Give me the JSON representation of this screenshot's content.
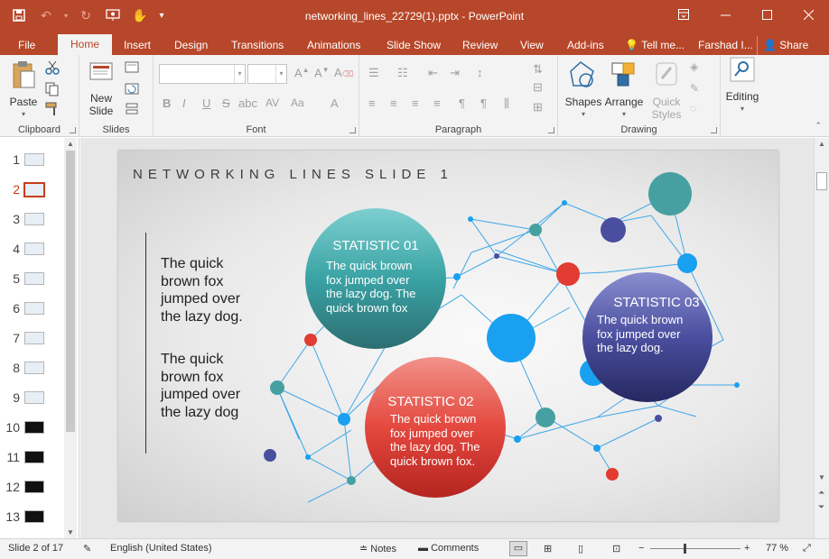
{
  "titlebar": {
    "doc_title": "networking_lines_22729(1).pptx - PowerPoint",
    "qat": {
      "save_icon": "save-icon",
      "undo_icon": "undo-icon",
      "redo_icon": "redo-icon"
    },
    "color": "#b7472a"
  },
  "tabs": [
    {
      "label": "File"
    },
    {
      "label": "Home"
    },
    {
      "label": "Insert"
    },
    {
      "label": "Design"
    },
    {
      "label": "Transitions"
    },
    {
      "label": "Animations"
    },
    {
      "label": "Slide Show"
    },
    {
      "label": "Review"
    },
    {
      "label": "View"
    },
    {
      "label": "Add-ins"
    },
    {
      "label": "Tell me..."
    },
    {
      "label": "Farshad I..."
    },
    {
      "label": "Share"
    }
  ],
  "ribbon": {
    "clipboard": {
      "label": "Clipboard",
      "paste_label": "Paste"
    },
    "slides": {
      "label": "Slides",
      "new_slide_label": "New Slide",
      "new_slide_line1": "New",
      "new_slide_line2": "Slide"
    },
    "font": {
      "label": "Font",
      "bold": "B",
      "italic": "I",
      "underline": "U",
      "strike": "S",
      "spacing": "AV",
      "case": "Aa",
      "color": "A"
    },
    "paragraph": {
      "label": "Paragraph"
    },
    "drawing": {
      "label": "Drawing",
      "shapes_label": "Shapes",
      "arrange_label": "Arrange",
      "quick_styles_line1": "Quick",
      "quick_styles_line2": "Styles"
    },
    "editing": {
      "label": "Editing"
    }
  },
  "thumbnails": [
    {
      "num": "1"
    },
    {
      "num": "2"
    },
    {
      "num": "3"
    },
    {
      "num": "4"
    },
    {
      "num": "5"
    },
    {
      "num": "6"
    },
    {
      "num": "7"
    },
    {
      "num": "8"
    },
    {
      "num": "9"
    },
    {
      "num": "10"
    },
    {
      "num": "11"
    },
    {
      "num": "12"
    },
    {
      "num": "13"
    }
  ],
  "slide": {
    "title": "NETWORKING LINES SLIDE 1",
    "left_text_1": [
      "The quick",
      "brown fox",
      "jumped over",
      "the lazy dog."
    ],
    "left_text_2": [
      "The quick",
      "brown fox",
      "jumped over",
      "the lazy dog"
    ],
    "stat1": {
      "title": "STATISTIC 01",
      "body": [
        "The quick brown",
        "fox jumped over",
        "the lazy dog. The",
        "quick brown fox"
      ]
    },
    "stat2": {
      "title": "STATISTIC 02",
      "body": [
        "The quick brown",
        "fox jumped over",
        "the lazy dog. The",
        "quick brown fox."
      ]
    },
    "stat3": {
      "title": "STATISTIC 03",
      "body": [
        "The quick brown",
        "fox jumped over",
        "the lazy dog."
      ]
    }
  },
  "statusbar": {
    "slide_count": "Slide 2 of 17",
    "language": "English (United States)",
    "notes": "Notes",
    "comments": "Comments",
    "zoom": "77 %"
  }
}
